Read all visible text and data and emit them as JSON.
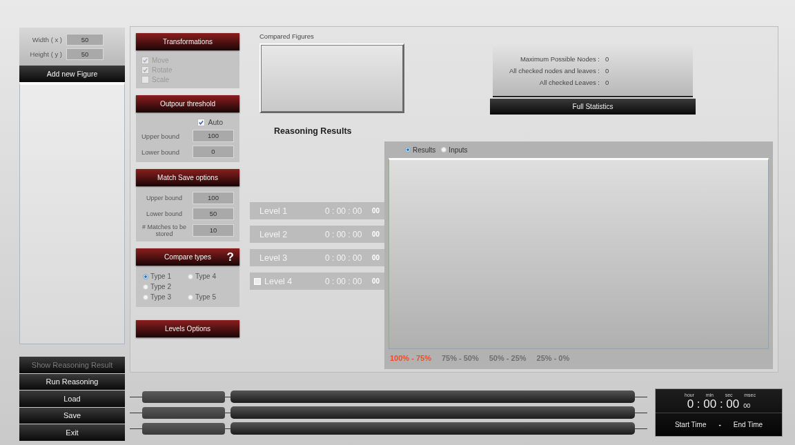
{
  "figure_size": [
    {
      "label": "Width ( x )",
      "value": "50"
    },
    {
      "label": "Height ( y )",
      "value": "50"
    }
  ],
  "add_figure_button": "Add new Figure",
  "side_buttons": [
    {
      "label": "Show Reasoning Result",
      "disabled": true
    },
    {
      "label": "Run Reasoning",
      "disabled": false
    },
    {
      "label": "Load",
      "disabled": false
    },
    {
      "label": "Save",
      "disabled": false
    },
    {
      "label": "Exit",
      "disabled": false
    }
  ],
  "transformations": {
    "title": "Transformations",
    "options": [
      {
        "label": "Move",
        "checked": true,
        "disabled": true
      },
      {
        "label": "Rotate",
        "checked": true,
        "disabled": true
      },
      {
        "label": "Scale",
        "checked": false,
        "disabled": true
      }
    ]
  },
  "outpour_threshold": {
    "title": "Outpour threshold",
    "auto": {
      "label": "Auto",
      "checked": true
    },
    "fields": [
      {
        "label": "Upper bound",
        "value": "100"
      },
      {
        "label": "Lower bound",
        "value": "0"
      }
    ]
  },
  "match_save_options": {
    "title": "Match Save options",
    "fields": [
      {
        "label": "Upper bound",
        "value": "100"
      },
      {
        "label": "Lower bound",
        "value": "50"
      },
      {
        "label": "# Matches to be stored",
        "value": "10"
      }
    ]
  },
  "compare_types": {
    "title": "Compare types",
    "help": "?",
    "rows": [
      [
        {
          "label": "Type 1",
          "selected": true
        },
        {
          "label": "Type 4",
          "selected": false
        }
      ],
      [
        {
          "label": "Type 2",
          "selected": false
        }
      ],
      [
        {
          "label": "Type 3",
          "selected": false
        },
        {
          "label": "Type 5",
          "selected": false
        }
      ]
    ]
  },
  "levels_options_button": "Levels Options",
  "compared_figures": {
    "label": "Compared Figures"
  },
  "statistics": {
    "rows": [
      {
        "label": "Maximum Possible Nodes :",
        "value": "0"
      },
      {
        "label": "All checked nodes and leaves :",
        "value": "0"
      },
      {
        "label": "All checked Leaves :",
        "value": "0"
      }
    ],
    "button": "Full Statistics"
  },
  "reasoning_results": {
    "title": "Reasoning Results",
    "levels": [
      {
        "kind": "plain",
        "label": "Level 1",
        "time": "0 : 00 : 00",
        "msec": "00"
      },
      {
        "kind": "plain",
        "label": "Level 2",
        "time": "0 : 00 : 00",
        "msec": "00"
      },
      {
        "kind": "plain",
        "label": "Level 3",
        "time": "0 : 00 : 00",
        "msec": "00"
      },
      {
        "kind": "checkbox",
        "label": "Level 4",
        "time": "0 : 00 : 00",
        "msec": "00",
        "checked": false
      }
    ],
    "view_tabs": [
      {
        "label": "Results",
        "selected": true
      },
      {
        "label": "Inputs",
        "selected": false
      }
    ],
    "legend": [
      {
        "label": "100% - 75%",
        "color": "#e8502a"
      },
      {
        "label": "75% - 50%",
        "color": "#6e6e6e"
      },
      {
        "label": "50% - 25%",
        "color": "#6e6e6e"
      },
      {
        "label": "25% - 0%",
        "color": "#6e6e6e"
      }
    ]
  },
  "timer": {
    "units": [
      "hour",
      "min",
      "sec",
      "msec"
    ],
    "time": "0 : 00 : 00",
    "msec": "00",
    "start_label": "Start Time",
    "separator": "-",
    "end_label": "End Time"
  }
}
